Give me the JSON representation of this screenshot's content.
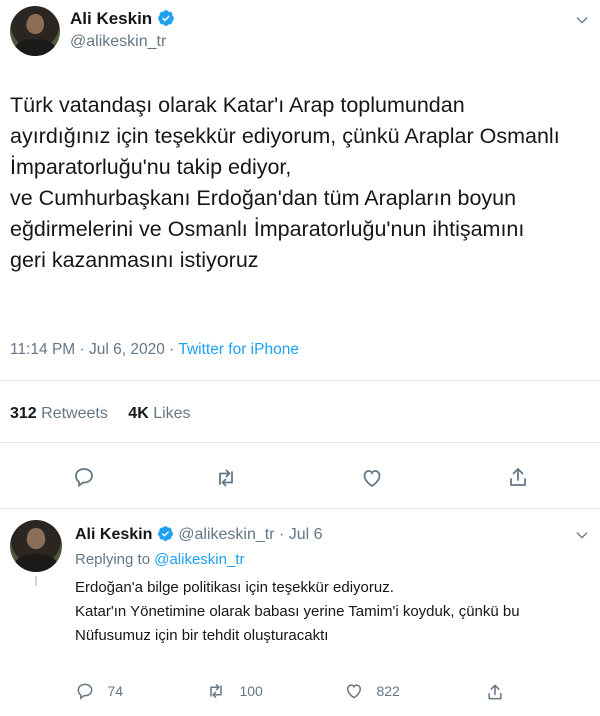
{
  "colors": {
    "accent": "#1da1f2",
    "text": "#14171a",
    "muted": "#657786",
    "divider": "#e1e8ed"
  },
  "main_tweet": {
    "author": {
      "name": "Ali Keskin",
      "handle": "@alikeskin_tr",
      "verified": true,
      "avatar_icon": "avatar-photo"
    },
    "text_lines": [
      "Türk vatandaşı olarak Katar'ı Arap toplumundan",
      "ayırdığınız için teşekkür ediyorum, çünkü Araplar Osmanlı",
      "İmparatorluğu'nu takip ediyor,",
      "ve Cumhurbaşkanı Erdoğan'dan tüm Arapların boyun",
      "eğdirmelerini ve Osmanlı İmparatorluğu'nun ihtişamını",
      "geri kazanmasını istiyoruz"
    ],
    "meta": {
      "time": "11:14 PM",
      "sep1": " · ",
      "date": "Jul 6, 2020",
      "sep2": " · ",
      "source": "Twitter for iPhone"
    },
    "stats": {
      "retweets_count": "312",
      "retweets_label": " Retweets",
      "likes_count": "4K",
      "likes_label": " Likes"
    },
    "actions": [
      "reply-icon",
      "retweet-icon",
      "like-icon",
      "share-icon"
    ]
  },
  "reply_tweet": {
    "author": {
      "name": "Ali Keskin",
      "handle": "@alikeskin_tr",
      "sep": " · ",
      "date": "Jul 6",
      "verified": true
    },
    "replying_prefix": "Replying to ",
    "replying_handle": "@alikeskin_tr",
    "text_lines": [
      "Erdoğan'a bilge politikası için teşekkür ediyoruz.",
      "Katar'ın Yönetimine olarak babası yerine Tamim'i koyduk, çünkü bu",
      "Nüfusumuz için bir tehdit oluşturacaktı"
    ],
    "actions": {
      "replies": "74",
      "retweets": "100",
      "likes": "822"
    }
  }
}
